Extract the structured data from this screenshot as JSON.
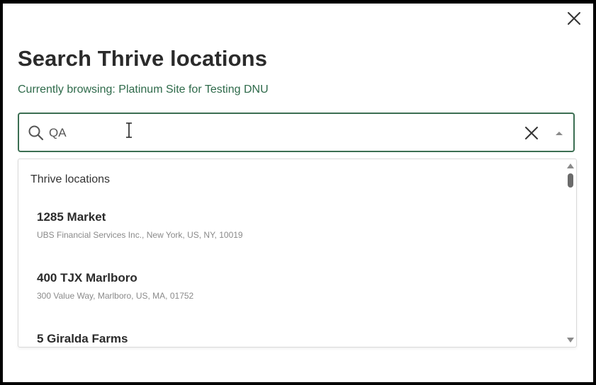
{
  "modal": {
    "title": "Search Thrive locations",
    "subtitle": "Currently browsing: Platinum Site for Testing DNU",
    "close_icon": "close-icon"
  },
  "search": {
    "value": "QA",
    "search_icon": "search-icon",
    "clear_icon": "clear-icon",
    "toggle_icon": "caret-up-icon"
  },
  "results": {
    "group_label": "Thrive locations",
    "items": [
      {
        "name": "1285 Market",
        "address": "UBS Financial Services Inc., New York, US, NY, 10019"
      },
      {
        "name": "400 TJX Marlboro",
        "address": "300 Value Way, Marlboro, US, MA, 01752"
      },
      {
        "name": "5 Giralda Farms",
        "address": ""
      }
    ]
  },
  "colors": {
    "accent_green": "#2e6a4a",
    "border_green": "#3b6e52",
    "title_text": "#2b2b2b",
    "secondary_text": "#8a8a8a"
  }
}
